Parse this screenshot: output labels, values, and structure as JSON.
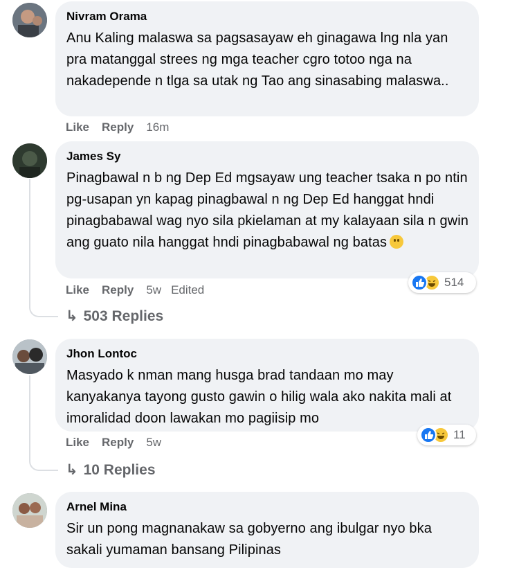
{
  "comments": [
    {
      "author": "Nivram Orama",
      "text": "Anu Kaling malaswa sa pagsasayaw eh ginagawa lng nla yan pra matanggal strees ng mga teacher cgro totoo nga na nakadepende n tlga sa utak ng Tao ang sinasabing malaswa..",
      "like": "Like",
      "reply": "Reply",
      "time": "16m"
    },
    {
      "author": "James Sy",
      "text": "Pinagbawal n b ng Dep Ed mgsayaw ung teacher tsaka n po ntin pg-usapan yn kapag pinagbawal n ng Dep Ed hanggat hndi pinagbabawal wag nyo sila pkielaman at my kalayaan sila n gwin ang guato nila hanggat hndi pinagbabawal ng batas",
      "like": "Like",
      "reply": "Reply",
      "time": "5w",
      "edited": "Edited",
      "reaction_count": "514",
      "replies": "503 Replies"
    },
    {
      "author": "Jhon Lontoc",
      "text": "Masyado k nman mang husga brad tandaan mo may kanyakanya tayong gusto gawin o hilig wala ako nakita mali at imoralidad doon lawakan mo pagiisip mo",
      "like": "Like",
      "reply": "Reply",
      "time": "5w",
      "reaction_count": "11",
      "replies": "10 Replies"
    },
    {
      "author": "Arnel Mina",
      "text": "Sir un pong magnanakaw sa gobyerno ang ibulgar nyo bka sakali yumaman bansang Pilipinas"
    }
  ],
  "icons": {
    "reply_arrow": "reply-arrow-icon",
    "like_reaction": "like-reaction-icon",
    "haha_reaction": "haha-reaction-icon",
    "smile_emoji": "smile-emoji-icon"
  },
  "colors": {
    "bubble": "#f0f2f5",
    "like_blue": "#1877f2",
    "haha_yellow": "#f7c83b",
    "secondary_text": "#65676b"
  }
}
